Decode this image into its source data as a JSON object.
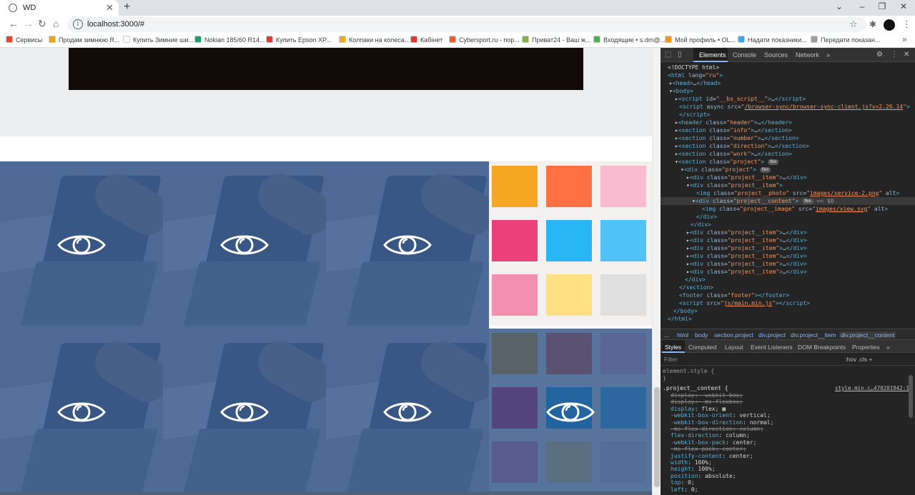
{
  "browser": {
    "tab_title": "WD",
    "tab_close": "✕",
    "new_tab": "+",
    "url": "localhost:3000/#",
    "window_controls": [
      "⌄",
      "–",
      "❐",
      "✕"
    ],
    "icons": [
      "favicon-globe",
      "back-arrow",
      "forward-arrow",
      "reload",
      "site-info",
      "star",
      "extensions-puzzle",
      "profile-avatar",
      "menu-dots"
    ]
  },
  "bookmarks": [
    {
      "label": "Сервисы",
      "color": "#ea4335"
    },
    {
      "label": "Продам зимнюю R...",
      "color": "#f4a300"
    },
    {
      "label": "Купить Зимние ши...",
      "color": "#ffffff"
    },
    {
      "label": "Nokian 185/60 R14...",
      "color": "#1aa260"
    },
    {
      "label": "Купить Epson XP...",
      "color": "#e53935"
    },
    {
      "label": "Колпаки на колеса...",
      "color": "#f9a825"
    },
    {
      "label": "Кабінет",
      "color": "#e53935"
    },
    {
      "label": "Cybersport.ru - пор...",
      "color": "#ff5722"
    },
    {
      "label": "Приват24 - Ваш ж...",
      "color": "#7cb342"
    },
    {
      "label": "Входящие • s.dm@...",
      "color": "#4caf50"
    },
    {
      "label": "Мой профиль • OL...",
      "color": "#ff9800"
    },
    {
      "label": "Надати показники...",
      "color": "#42a5f5"
    },
    {
      "label": "Передати показан...",
      "color": "#9e9e9e"
    }
  ],
  "bookmarks_more": "»",
  "page": {
    "colors": {
      "overlay": "#204880",
      "work_bg": "#ecedef"
    },
    "projects": [
      {
        "id": 1,
        "photo": "desk",
        "overlay": true
      },
      {
        "id": 2,
        "photo": "desk",
        "overlay": true
      },
      {
        "id": 3,
        "photo": "desk",
        "overlay": true
      },
      {
        "id": 4,
        "photo": "notes",
        "overlay": false
      },
      {
        "id": 5,
        "photo": "desk",
        "overlay": true
      },
      {
        "id": 6,
        "photo": "desk",
        "overlay": true
      },
      {
        "id": 7,
        "photo": "desk",
        "overlay": true
      },
      {
        "id": 8,
        "photo": "notes",
        "overlay": true
      }
    ]
  },
  "devtools": {
    "tabs": [
      "Elements",
      "Console",
      "Sources",
      "Network"
    ],
    "tabs_more": "»",
    "breadcrumbs": [
      "...",
      "html",
      "body",
      "section.project",
      "div.project",
      "div.project__item",
      "div.project__content"
    ],
    "styles_tabs": [
      "Styles",
      "Computed",
      "Layout",
      "Event Listeners",
      "DOM Breakpoints",
      "Properties"
    ],
    "styles_more": "»",
    "filter_placeholder": "Filter",
    "filter_buttons": ":hov  .cls  +",
    "element_style": "element.style {",
    "close_brace": "}",
    "rule_selector": ".project__content {",
    "rule_source": "style.min.c…470201942:1",
    "declarations": [
      {
        "prop": "display",
        "val": "-webkit-box;",
        "struck": true
      },
      {
        "prop": "display",
        "val": "-ms-flexbox;",
        "struck": true
      },
      {
        "prop": "display",
        "val": "flex; ▦",
        "struck": false
      },
      {
        "prop": "-webkit-box-orient",
        "val": "vertical;",
        "struck": false
      },
      {
        "prop": "-webkit-box-direction",
        "val": "normal;",
        "struck": false
      },
      {
        "prop": "-ms-flex-direction",
        "val": "column;",
        "struck": true
      },
      {
        "prop": "flex-direction",
        "val": "column;",
        "struck": false
      },
      {
        "prop": "-webkit-box-pack",
        "val": "center;",
        "struck": false
      },
      {
        "prop": "-ms-flex-pack",
        "val": "center;",
        "struck": true
      },
      {
        "prop": "justify-content",
        "val": "center;",
        "struck": false
      },
      {
        "prop": "width",
        "val": "100%;",
        "struck": false
      },
      {
        "prop": "height",
        "val": "100%;",
        "struck": false
      },
      {
        "prop": "position",
        "val": "absolute;",
        "struck": false
      },
      {
        "prop": "top",
        "val": "0;",
        "struck": false
      },
      {
        "prop": "left",
        "val": "0;",
        "struck": false
      }
    ]
  }
}
